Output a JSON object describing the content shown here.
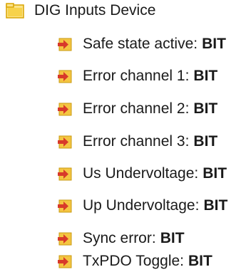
{
  "tree": {
    "root": {
      "label": "DIG Inputs Device",
      "icon": "folder-icon"
    },
    "children": [
      {
        "label": "Safe state active:",
        "type": "BIT",
        "icon": "input-variable-icon"
      },
      {
        "label": "Error channel 1:",
        "type": "BIT",
        "icon": "input-variable-icon"
      },
      {
        "label": "Error channel 2:",
        "type": "BIT",
        "icon": "input-variable-icon"
      },
      {
        "label": "Error channel 3:",
        "type": "BIT",
        "icon": "input-variable-icon"
      },
      {
        "label": "Us Undervoltage:",
        "type": "BIT",
        "icon": "input-variable-icon"
      },
      {
        "label": "Up Undervoltage:",
        "type": "BIT",
        "icon": "input-variable-icon"
      },
      {
        "label": "Sync error:",
        "type": "BIT",
        "icon": "input-variable-icon"
      },
      {
        "label": "TxPDO Toggle:",
        "type": "BIT",
        "icon": "input-variable-icon"
      }
    ]
  },
  "colors": {
    "folder_fill": "#f5d76e",
    "folder_stroke": "#d9a400",
    "var_fill": "#f4c542",
    "arrow_red": "#d83a2a"
  }
}
